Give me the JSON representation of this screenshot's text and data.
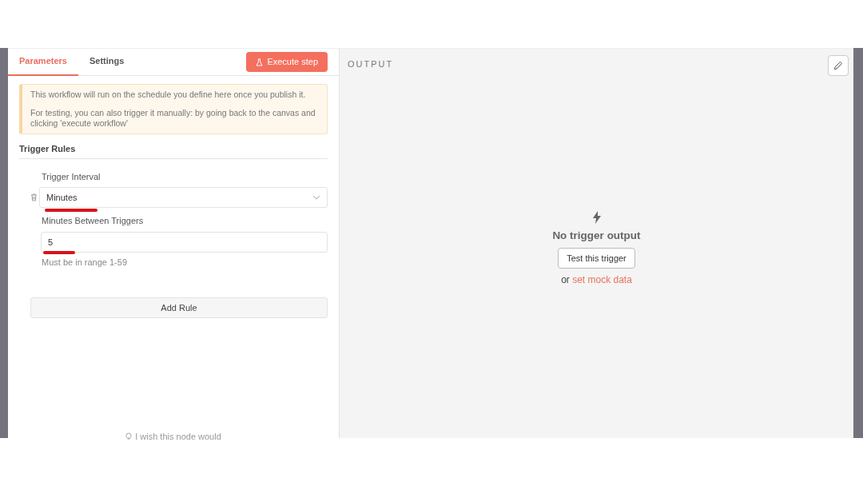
{
  "tabs": [
    {
      "label": "Parameters",
      "selected": true
    },
    {
      "label": "Settings",
      "selected": false
    }
  ],
  "execute_button": {
    "label": "Execute step"
  },
  "notice": {
    "paragraphs": [
      "This workflow will run on the schedule you define here once you publish it.",
      "For testing, you can also trigger it manually: by going back to the canvas and clicking 'execute workflow'"
    ]
  },
  "section_title": "Trigger Rules",
  "rule": {
    "interval_label": "Trigger Interval",
    "interval_value": "Minutes",
    "minutes_label": "Minutes Between Triggers",
    "minutes_value": "5",
    "hint": "Must be in range 1-59"
  },
  "add_rule_button": "Add Rule",
  "feedback_text": "I wish this node would",
  "output": {
    "title": "OUTPUT",
    "empty_title": "No trigger output",
    "test_button": "Test this trigger",
    "or_text": "or",
    "mock_link": "set mock data"
  }
}
